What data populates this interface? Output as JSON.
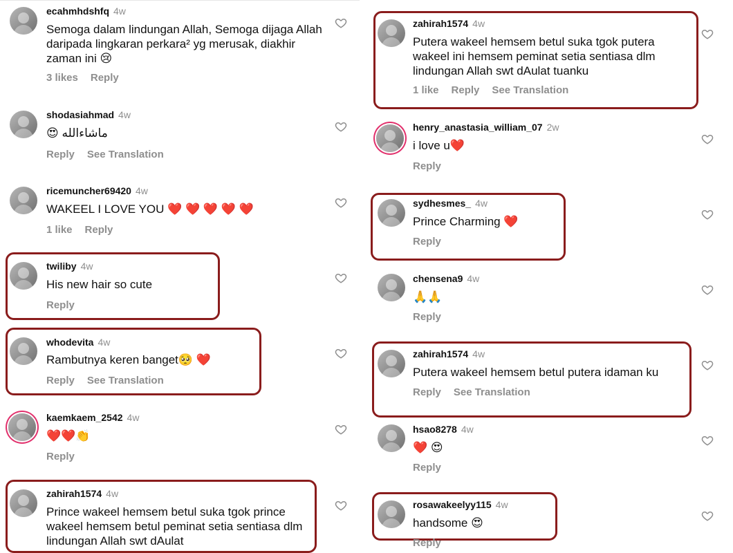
{
  "left": {
    "comments": [
      {
        "username": "ecahmhdshfq",
        "time": "4w",
        "text": "Semoga dalam lindungan Allah, Semoga dijaga Allah daripada lingkaran perkara² yg merusak, diakhir zaman ini 😢",
        "likes": "3 likes",
        "reply": "Reply"
      },
      {
        "username": "shodasiahmad",
        "time": "4w",
        "text": "😍 ماشاءالله",
        "reply": "Reply",
        "translate": "See Translation"
      },
      {
        "username": "ricemuncher69420",
        "time": "4w",
        "text": "WAKEEL I LOVE YOU ❤️ ❤️ ❤️ ❤️ ❤️",
        "likes": "1 like",
        "reply": "Reply"
      },
      {
        "username": "twiliby",
        "time": "4w",
        "text": "His new hair so cute",
        "reply": "Reply"
      },
      {
        "username": "whodevita",
        "time": "4w",
        "text": "Rambutnya keren banget🥺 ❤️",
        "reply": "Reply",
        "translate": "See Translation"
      },
      {
        "username": "kaemkaem_2542",
        "time": "4w",
        "text": "❤️❤️👏",
        "reply": "Reply"
      },
      {
        "username": "zahirah1574",
        "time": "4w",
        "text": "Prince wakeel hemsem betul suka tgok prince wakeel hemsem betul peminat setia sentiasa dlm lindungan Allah swt dAulat"
      }
    ]
  },
  "right": {
    "comments": [
      {
        "username": "zahirah1574",
        "time": "4w",
        "text": "Putera wakeel hemsem betul suka tgok putera wakeel ini hemsem peminat setia sentiasa dlm lindungan Allah swt dAulat tuanku",
        "likes": "1 like",
        "reply": "Reply",
        "translate": "See Translation"
      },
      {
        "username": "henry_anastasia_william_07",
        "time": "2w",
        "text": "i love u❤️",
        "reply": "Reply"
      },
      {
        "username": "sydhesmes_",
        "time": "4w",
        "text": "Prince Charming ❤️",
        "reply": "Reply"
      },
      {
        "username": "chensena9",
        "time": "4w",
        "text": "🙏🙏",
        "reply": "Reply"
      },
      {
        "username": "zahirah1574",
        "time": "4w",
        "text": "Putera wakeel hemsem betul putera idaman ku",
        "reply": "Reply",
        "translate": "See Translation"
      },
      {
        "username": "hsao8278",
        "time": "4w",
        "text": "❤️ 😍",
        "reply": "Reply"
      },
      {
        "username": "rosawakeelyy115",
        "time": "4w",
        "text": "handsome 😍",
        "reply": "Reply"
      }
    ]
  },
  "icons": {
    "like": "heart-outline-icon",
    "avatar": "avatar-icon"
  },
  "colors": {
    "highlight": "#8a1c1c",
    "meta": "#8e8e8e",
    "story_ring": "#e1306c"
  }
}
